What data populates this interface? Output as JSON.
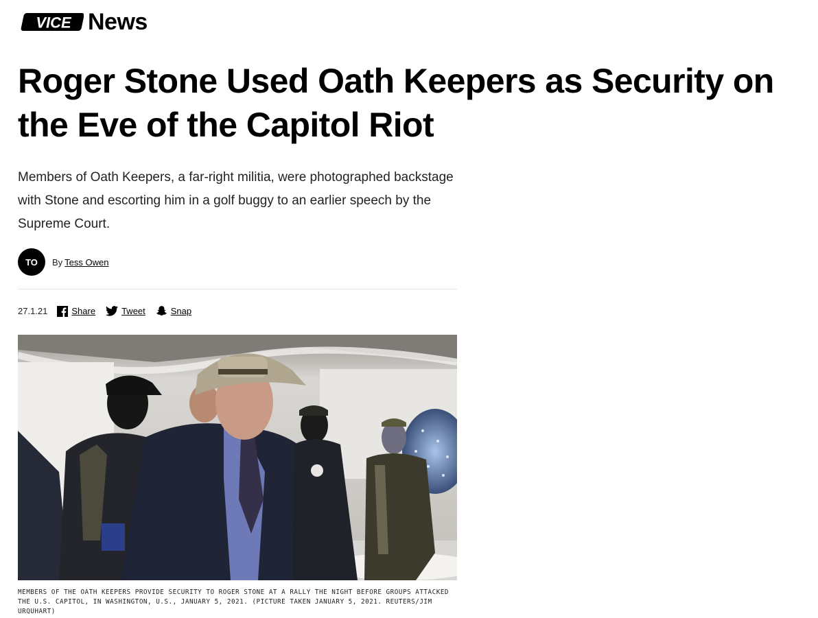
{
  "site": {
    "logo_text": "VICE",
    "section_name": "News"
  },
  "article": {
    "headline": "Roger Stone Used Oath Keepers as Security on the Eve of the Capitol Riot",
    "dek": "Members of Oath Keepers, a far-right militia, were photographed backstage with Stone and escorting him in a golf buggy to an earlier speech by the Supreme Court.",
    "author_initials": "TO",
    "by_prefix": "By",
    "author_name": "Tess Owen",
    "date": "27.1.21",
    "image_caption": "MEMBERS OF THE OATH KEEPERS PROVIDE SECURITY TO ROGER STONE AT A RALLY THE NIGHT BEFORE GROUPS ATTACKED THE U.S. CAPITOL, IN WASHINGTON, U.S., JANUARY 5, 2021. (PICTURE TAKEN JANUARY 5, 2021. REUTERS/JIM URQUHART)"
  },
  "share": [
    {
      "label": "Share",
      "icon": "facebook-icon"
    },
    {
      "label": "Tweet",
      "icon": "twitter-icon"
    },
    {
      "label": "Snap",
      "icon": "snapchat-icon"
    }
  ],
  "colors": {
    "text": "#000000",
    "avatar_bg": "#000000",
    "divider": "#e2e2e2",
    "tent_white": "#ecebe8",
    "suit_navy": "#1f2436"
  }
}
